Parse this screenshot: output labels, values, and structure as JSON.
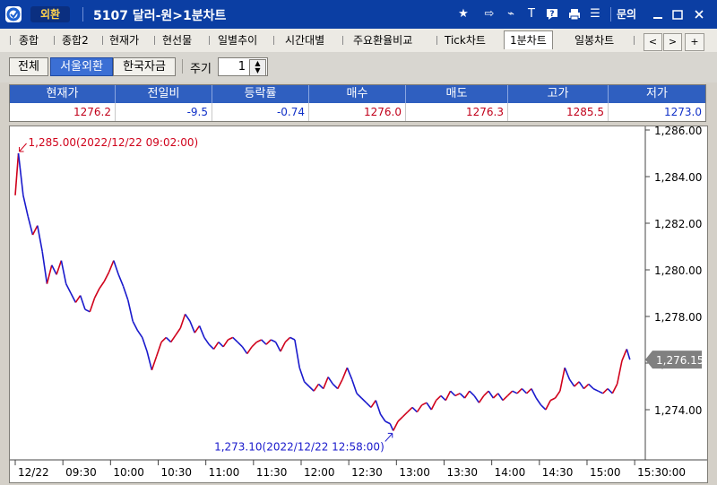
{
  "titlebar": {
    "tag": "외환",
    "title": "5107 달러-원>1분차트",
    "inquiry": "문의",
    "icons": [
      "star-icon",
      "export-icon",
      "link-icon",
      "text-icon",
      "help-icon",
      "print-icon",
      "list-icon",
      "minimize-icon",
      "maximize-icon",
      "close-icon"
    ]
  },
  "tabs": [
    {
      "label": "종합",
      "active": false
    },
    {
      "label": "종합2",
      "active": false
    },
    {
      "label": "현재가",
      "active": false
    },
    {
      "label": "현선물",
      "active": false
    },
    {
      "label": "일별추이",
      "active": false
    },
    {
      "label": "시간대별",
      "active": false
    },
    {
      "label": "주요환율비교",
      "active": false
    },
    {
      "label": "Tick차트",
      "active": false
    },
    {
      "label": "1분차트",
      "active": true
    },
    {
      "label": "일봉차트",
      "active": false
    }
  ],
  "tab_scroll": {
    "left": "<",
    "right": ">",
    "plus": "+"
  },
  "filters": {
    "all": "전체",
    "seoul": "서울외환",
    "kfc": "한국자금",
    "period_label": "주기",
    "period_value": "1",
    "selected": "서울외환"
  },
  "quote": {
    "headers": [
      "현재가",
      "전일비",
      "등락률",
      "매수",
      "매도",
      "고가",
      "저가"
    ],
    "values": [
      "1276.2",
      "-9.5",
      "-0.74",
      "1276.0",
      "1276.3",
      "1285.5",
      "1273.0"
    ],
    "colors": [
      "red",
      "blue",
      "blue",
      "red",
      "red",
      "red",
      "blue"
    ]
  },
  "chart_data": {
    "type": "line",
    "title": "",
    "xlabel": "",
    "ylabel": "",
    "x_ticks": [
      "12/22",
      "09:30",
      "10:00",
      "10:30",
      "11:00",
      "11:30",
      "12:00",
      "12:30",
      "13:00",
      "13:30",
      "14:00",
      "14:30",
      "15:00",
      "15:30:00"
    ],
    "y_ticks": [
      "1,286.00",
      "1,284.00",
      "1,282.00",
      "1,280.00",
      "1,278.00",
      "1,276.00",
      "1,274.00"
    ],
    "ylim": [
      1272.0,
      1286.0
    ],
    "xlim": [
      "09:00",
      "15:35"
    ],
    "grid": false,
    "current_value_label": "1,276.15",
    "high_annotation": "1,285.00(2022/12/22 09:02:00)",
    "low_annotation": "1,273.10(2022/12/22 12:58:00)",
    "up_color": "#d0021b",
    "down_color": "#1a1acc",
    "series": [
      {
        "points": [
          [
            "09:00",
            1283.2
          ],
          [
            "09:02",
            1285.0
          ],
          [
            "09:05",
            1283.2
          ],
          [
            "09:08",
            1282.3
          ],
          [
            "09:11",
            1281.5
          ],
          [
            "09:14",
            1281.9
          ],
          [
            "09:17",
            1280.8
          ],
          [
            "09:20",
            1279.4
          ],
          [
            "09:23",
            1280.2
          ],
          [
            "09:26",
            1279.8
          ],
          [
            "09:29",
            1280.4
          ],
          [
            "09:32",
            1279.4
          ],
          [
            "09:35",
            1279.0
          ],
          [
            "09:38",
            1278.6
          ],
          [
            "09:41",
            1278.9
          ],
          [
            "09:44",
            1278.3
          ],
          [
            "09:47",
            1278.2
          ],
          [
            "09:50",
            1278.8
          ],
          [
            "09:53",
            1279.2
          ],
          [
            "09:56",
            1279.5
          ],
          [
            "09:59",
            1279.9
          ],
          [
            "10:02",
            1280.4
          ],
          [
            "10:05",
            1279.8
          ],
          [
            "10:08",
            1279.3
          ],
          [
            "10:11",
            1278.7
          ],
          [
            "10:14",
            1277.8
          ],
          [
            "10:17",
            1277.4
          ],
          [
            "10:20",
            1277.1
          ],
          [
            "10:23",
            1276.5
          ],
          [
            "10:26",
            1275.7
          ],
          [
            "10:29",
            1276.3
          ],
          [
            "10:32",
            1276.9
          ],
          [
            "10:35",
            1277.1
          ],
          [
            "10:38",
            1276.9
          ],
          [
            "10:41",
            1277.2
          ],
          [
            "10:44",
            1277.5
          ],
          [
            "10:47",
            1278.1
          ],
          [
            "10:50",
            1277.8
          ],
          [
            "10:53",
            1277.3
          ],
          [
            "10:56",
            1277.6
          ],
          [
            "10:59",
            1277.1
          ],
          [
            "11:02",
            1276.8
          ],
          [
            "11:05",
            1276.6
          ],
          [
            "11:08",
            1276.9
          ],
          [
            "11:11",
            1276.7
          ],
          [
            "11:14",
            1277.0
          ],
          [
            "11:17",
            1277.1
          ],
          [
            "11:20",
            1276.9
          ],
          [
            "11:23",
            1276.7
          ],
          [
            "11:26",
            1276.4
          ],
          [
            "11:29",
            1276.7
          ],
          [
            "11:32",
            1276.9
          ],
          [
            "11:35",
            1277.0
          ],
          [
            "11:38",
            1276.8
          ],
          [
            "11:41",
            1277.0
          ],
          [
            "11:44",
            1276.9
          ],
          [
            "11:47",
            1276.5
          ],
          [
            "11:50",
            1276.9
          ],
          [
            "11:53",
            1277.1
          ],
          [
            "11:56",
            1277.0
          ],
          [
            "11:59",
            1275.8
          ],
          [
            "12:02",
            1275.2
          ],
          [
            "12:05",
            1275.0
          ],
          [
            "12:08",
            1274.8
          ],
          [
            "12:11",
            1275.1
          ],
          [
            "12:14",
            1274.9
          ],
          [
            "12:17",
            1275.4
          ],
          [
            "12:20",
            1275.1
          ],
          [
            "12:23",
            1274.9
          ],
          [
            "12:26",
            1275.3
          ],
          [
            "12:29",
            1275.8
          ],
          [
            "12:32",
            1275.3
          ],
          [
            "12:35",
            1274.7
          ],
          [
            "12:38",
            1274.5
          ],
          [
            "12:41",
            1274.3
          ],
          [
            "12:44",
            1274.1
          ],
          [
            "12:47",
            1274.4
          ],
          [
            "12:50",
            1273.8
          ],
          [
            "12:53",
            1273.5
          ],
          [
            "12:56",
            1273.4
          ],
          [
            "12:58",
            1273.1
          ],
          [
            "13:01",
            1273.5
          ],
          [
            "13:04",
            1273.7
          ],
          [
            "13:07",
            1273.9
          ],
          [
            "13:10",
            1274.1
          ],
          [
            "13:13",
            1273.9
          ],
          [
            "13:16",
            1274.2
          ],
          [
            "13:19",
            1274.3
          ],
          [
            "13:22",
            1274.0
          ],
          [
            "13:25",
            1274.4
          ],
          [
            "13:28",
            1274.6
          ],
          [
            "13:31",
            1274.4
          ],
          [
            "13:34",
            1274.8
          ],
          [
            "13:37",
            1274.6
          ],
          [
            "13:40",
            1274.7
          ],
          [
            "13:43",
            1274.5
          ],
          [
            "13:46",
            1274.8
          ],
          [
            "13:49",
            1274.6
          ],
          [
            "13:52",
            1274.3
          ],
          [
            "13:55",
            1274.6
          ],
          [
            "13:58",
            1274.8
          ],
          [
            "14:01",
            1274.5
          ],
          [
            "14:04",
            1274.7
          ],
          [
            "14:07",
            1274.4
          ],
          [
            "14:10",
            1274.6
          ],
          [
            "14:13",
            1274.8
          ],
          [
            "14:16",
            1274.7
          ],
          [
            "14:19",
            1274.9
          ],
          [
            "14:22",
            1274.7
          ],
          [
            "14:25",
            1274.9
          ],
          [
            "14:28",
            1274.5
          ],
          [
            "14:31",
            1274.2
          ],
          [
            "14:34",
            1274.0
          ],
          [
            "14:37",
            1274.4
          ],
          [
            "14:40",
            1274.5
          ],
          [
            "14:43",
            1274.8
          ],
          [
            "14:46",
            1275.8
          ],
          [
            "14:49",
            1275.3
          ],
          [
            "14:52",
            1275.0
          ],
          [
            "14:55",
            1275.2
          ],
          [
            "14:58",
            1274.9
          ],
          [
            "15:01",
            1275.1
          ],
          [
            "15:04",
            1274.9
          ],
          [
            "15:07",
            1274.8
          ],
          [
            "15:10",
            1274.7
          ],
          [
            "15:13",
            1274.9
          ],
          [
            "15:16",
            1274.7
          ],
          [
            "15:19",
            1275.1
          ],
          [
            "15:22",
            1276.1
          ],
          [
            "15:25",
            1276.6
          ],
          [
            "15:27",
            1276.15
          ]
        ]
      }
    ]
  }
}
